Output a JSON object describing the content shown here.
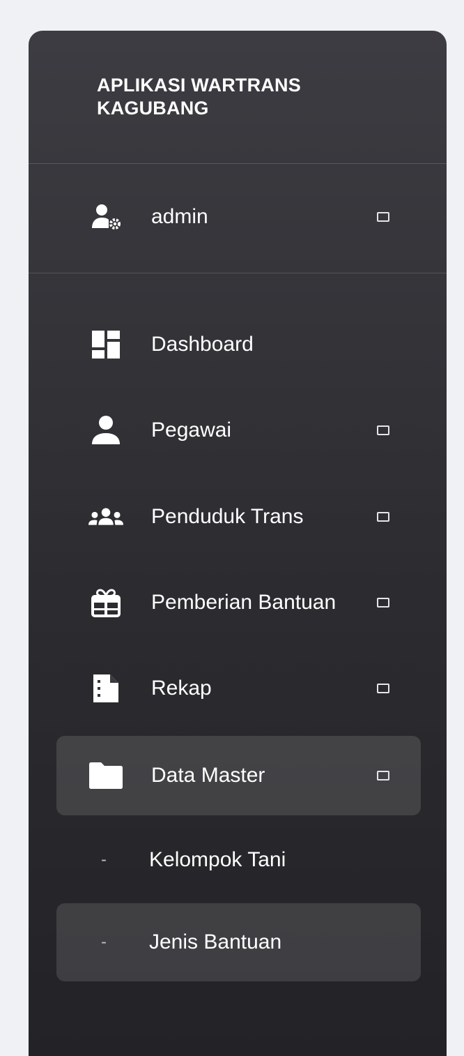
{
  "brand": {
    "line1": "APLIKASI WARTRANS",
    "line2": "KAGUBANG"
  },
  "user": {
    "name": "admin",
    "icon": "user-gear-icon"
  },
  "menu": {
    "items": [
      {
        "label": "Dashboard",
        "icon": "dashboard-icon"
      },
      {
        "label": "Pegawai",
        "icon": "user-icon"
      },
      {
        "label": "Penduduk Trans",
        "icon": "users-icon"
      },
      {
        "label": "Pemberian Bantuan",
        "icon": "gift-icon"
      },
      {
        "label": "Rekap",
        "icon": "file-icon"
      },
      {
        "label": "Data Master",
        "icon": "folder-icon"
      }
    ],
    "submenu": [
      {
        "marker": "-",
        "label": "Kelompok Tani"
      },
      {
        "marker": "-",
        "label": "Jenis Bantuan"
      }
    ]
  },
  "colors": {
    "page_background": "#eff1f5",
    "sidebar_top": "#3c3c42",
    "sidebar_bottom": "#232327",
    "text": "#ffffff"
  }
}
